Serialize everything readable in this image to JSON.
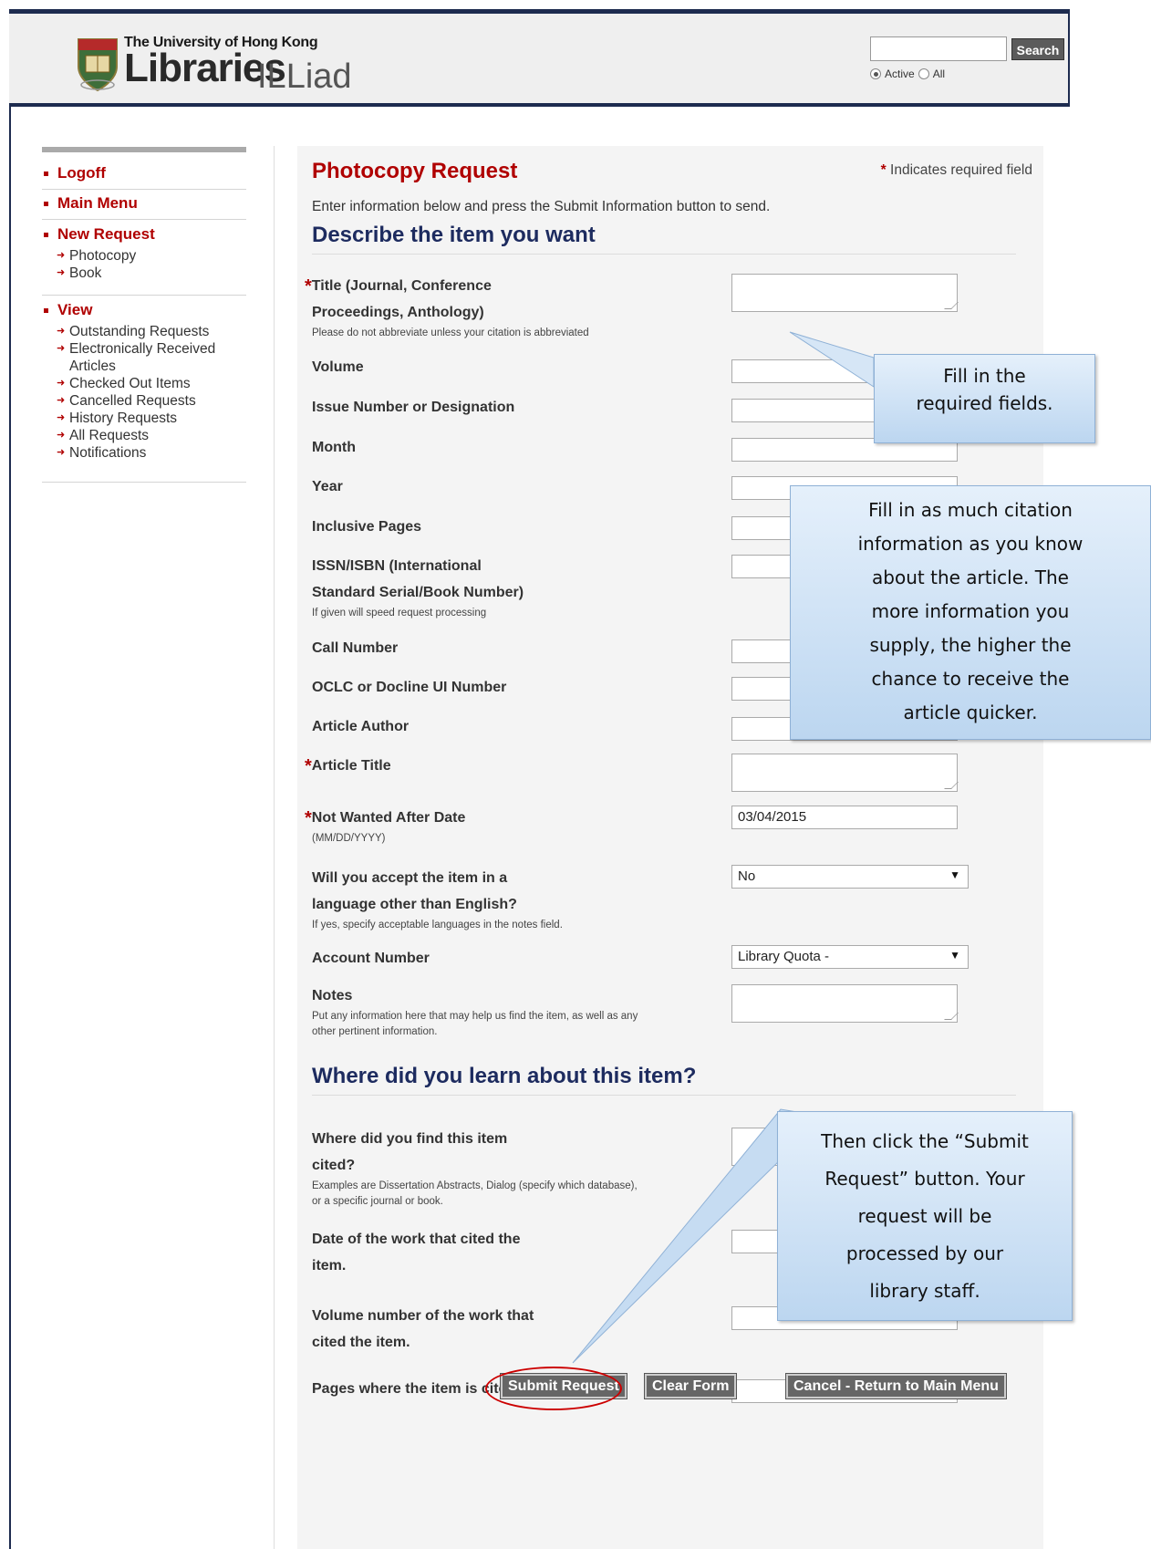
{
  "header": {
    "university": "The University of Hong Kong",
    "libraries": "Libraries",
    "app_name": "ILLiad",
    "search": {
      "value": "",
      "button": "Search",
      "radio_active": "Active",
      "radio_all": "All",
      "selected": "Active"
    }
  },
  "sidebar": {
    "logoff": "Logoff",
    "main_menu": "Main Menu",
    "new_request": {
      "label": "New Request",
      "items": [
        "Photocopy",
        "Book"
      ]
    },
    "view": {
      "label": "View",
      "items": [
        "Outstanding Requests",
        "Electronically Received",
        "Articles",
        "Checked Out Items",
        "Cancelled Requests",
        "History Requests",
        "All Requests",
        "Notifications"
      ]
    }
  },
  "main": {
    "title": "Photocopy Request",
    "required_star": "*",
    "required_note": "Indicates required field",
    "intro": "Enter information below and press the Submit Information button to send.",
    "section1": "Describe the item you want",
    "section2": "Where did you learn about this item?",
    "fields": {
      "title_line1": "Title (Journal, Conference",
      "title_line2": "Proceedings, Anthology)",
      "title_hint": "Please do not abbreviate unless your citation is abbreviated",
      "volume": "Volume",
      "issue": "Issue Number or Designation",
      "month": "Month",
      "year": "Year",
      "pages": "Inclusive Pages",
      "issn_line1": "ISSN/ISBN (International",
      "issn_line2": "Standard Serial/Book Number)",
      "issn_hint": "If given will speed request processing",
      "call_number": "Call Number",
      "oclc": "OCLC or Docline UI Number",
      "author": "Article Author",
      "article_title": "Article Title",
      "not_wanted": "Not Wanted After Date",
      "not_wanted_hint": "(MM/DD/YYYY)",
      "not_wanted_value": "03/04/2015",
      "lang_line1": "Will you accept the item in a",
      "lang_line2": "language other than English?",
      "lang_hint": "If yes, specify acceptable languages in the notes field.",
      "lang_value": "No",
      "account": "Account Number",
      "account_value": "Library Quota -",
      "notes": "Notes",
      "notes_hint1": "Put any information here that may help us find the item, as well as any",
      "notes_hint2": "other pertinent information.",
      "cited_line1": "Where did you find this item",
      "cited_line2": "cited?",
      "cited_hint1": "Examples are Dissertation Abstracts, Dialog (specify which database),",
      "cited_hint2": "or a specific journal or book.",
      "cited_date_line1": "Date of the work that cited the",
      "cited_date_line2": "item.",
      "cited_vol_line1": "Volume number of the work that",
      "cited_vol_line2": "cited the item.",
      "cited_pages": "Pages where the item is cited."
    },
    "buttons": {
      "submit": "Submit Request",
      "clear": "Clear Form",
      "cancel": "Cancel - Return to Main Menu"
    }
  },
  "callouts": {
    "required": [
      "Fill in the",
      "required fields."
    ],
    "citation": [
      "Fill in as much citation",
      "information as you know",
      "about the article. The",
      "more information you",
      "supply, the higher the",
      "chance to receive the",
      "article quicker."
    ],
    "submit": [
      "Then click the “Submit",
      "Request” button. Your",
      "request will be",
      "processed by our",
      "library staff."
    ]
  }
}
